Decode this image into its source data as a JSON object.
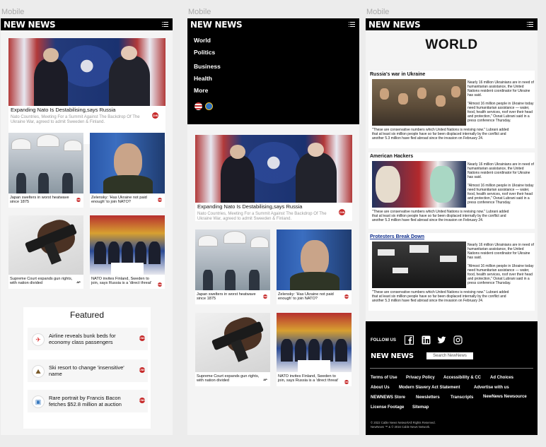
{
  "frames": [
    {
      "label": "Mobile"
    },
    {
      "label": "Mobile"
    },
    {
      "label": "Mobile"
    }
  ],
  "brand": {
    "logo": "NEW NEWS"
  },
  "nav": {
    "items": [
      "World",
      "Politics",
      "Business",
      "Health",
      "More"
    ]
  },
  "hero": {
    "title": "Expanding Nato Is Destabilising,says Russia",
    "subtitle": "Nato Countries, Meeting For a Summit Against The Backdrop Of The Ukraine War, agreed to admit Sweeden & Finland.",
    "badge": "CNN"
  },
  "grid": [
    {
      "caption": "Japan swelters in worst heatwave since 1875",
      "badge": "CNN"
    },
    {
      "caption": "Zelensky: 'Has Ukraine not paid enough' to join NATO?",
      "badge": "CNN"
    },
    {
      "caption": "Supreme Court expands gun rights, with nation divided",
      "badge": "AP"
    },
    {
      "caption": "NATO invites Finland, Sweden to join, says Russia is a 'direct threat'",
      "badge": "CNN"
    }
  ],
  "featured": {
    "title": "Featured",
    "items": [
      {
        "text": "Airline reveals bunk beds for economy class passengers",
        "badge": "CNN"
      },
      {
        "text": "Ski resort to change 'insensitive' name",
        "badge": "CNN"
      },
      {
        "text": "Rare portrait by Francis Bacon fetches $52.8 million at auction",
        "badge": "CNN"
      }
    ]
  },
  "world": {
    "title": "WORLD",
    "articles": [
      {
        "heading": "Russia's war in Ukraine",
        "side": "Nearly 16 million Ukrainians are in need of humanitarian assistance, the United Nations resident coordinator for Ukraine has said.",
        "side2": "\"Almost 16 million people in Ukraine today need humanitarian assistance — water, food, health services, roof over their head and protection,\" Osnat Lubrani said in a press conference Thursday.",
        "bottom": "\"These are conservative numbers which United Nations is revising now.\" Lubrani added that at least six million people have so far been displaced internally by the conflict and another 5.3 million have fled abroad since the invasion on February 24."
      },
      {
        "heading": "American Hackers",
        "side": "Nearly 16 million Ukrainians are in need of humanitarian assistance, the United Nations resident coordinator for Ukraine has said.",
        "side2": "\"Almost 16 million people in Ukraine today need humanitarian assistance — water, food, health services, roof over their head and protection,\" Osnat Lubrani said in a press conference Thursday.",
        "bottom": "\"These are conservative numbers which United Nations is revising now.\" Lubrani added that at least six million people have so far been displaced internally by the conflict and another 5.3 million have fled abroad since the invasion on February 24."
      },
      {
        "heading": "Protesters Break Down",
        "side": "Nearly 16 million Ukrainians are in need of humanitarian assistance, the United Nations resident coordinator for Ukraine has said.",
        "side2": "\"Almost 16 million people in Ukraine today need humanitarian assistance — water, food, health services, roof over their head and protection,\" Osnat Lubrani said in a press conference Thursday.",
        "bottom": "\"These are conservative numbers which United Nations is revising now.\" Lubrani added that at least six million people have so far been displaced internally by the conflict and another 5.3 million have fled abroad since the invasion on February 24."
      }
    ]
  },
  "footer": {
    "follow": "FOLLOW US",
    "logo": "NEW NEWS",
    "search_placeholder": "Search NewNews",
    "links": [
      "Terms of Use",
      "Privacy Policy",
      "Accessibility & CC",
      "Ad Choices",
      "About Us",
      "Modern Slavery Act Statement",
      "Advertise with us",
      "NEWNEWS Store",
      "Newsletters",
      "Transcripts",
      "NewNews Newsource",
      "License Footage",
      "Sitemap"
    ],
    "copyright": "© 2022 Cable News NetworkAll Rights Reserved.",
    "trademark": "NewNews ™ & © 2016 Cable News Network."
  },
  "colors": {
    "accent": "#c62828",
    "bar": "#000000",
    "link": "#0b2b8c"
  }
}
